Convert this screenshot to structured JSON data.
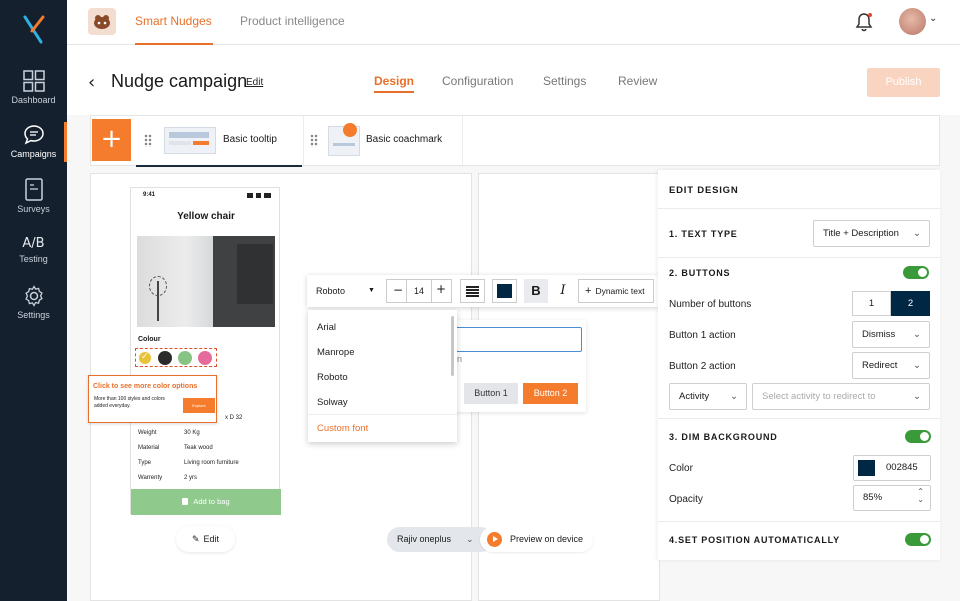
{
  "sidebar": {
    "items": [
      {
        "label": "Dashboard",
        "icon": "grid-icon"
      },
      {
        "label": "Campaigns",
        "icon": "chat-icon",
        "active": true
      },
      {
        "label": "Surveys",
        "icon": "document-icon"
      },
      {
        "label": "Testing",
        "icon": "ab-icon",
        "glyph": "A/B"
      },
      {
        "label": "Settings",
        "icon": "gear-icon"
      }
    ]
  },
  "topbar": {
    "tabs": [
      {
        "label": "Smart Nudges",
        "active": true
      },
      {
        "label": "Product intelligence"
      }
    ]
  },
  "header": {
    "title": "Nudge campaign",
    "edit_link": "Edit",
    "tabs": [
      "Design",
      "Configuration",
      "Settings",
      "Review"
    ],
    "active_tab": "Design",
    "publish_label": "Publish"
  },
  "templates": [
    {
      "label": "Basic tooltip",
      "active": true
    },
    {
      "label": "Basic coachmark"
    }
  ],
  "phone": {
    "time": "9:41",
    "product_title": "Yellow chair",
    "colour_label": "Colour",
    "colors": [
      "#e9c23b",
      "#2b2b2b",
      "#86c483",
      "#e46b9b"
    ],
    "tooltip": {
      "title": "Click to see more color options",
      "body": "More than 100 styles and colors added everyday.",
      "button": "Explore"
    },
    "partial_text": "x D 32",
    "specs": [
      {
        "key": "Weight",
        "value": "30 Kg"
      },
      {
        "key": "Material",
        "value": "Teak wood"
      },
      {
        "key": "Type",
        "value": "Living room furniture"
      },
      {
        "key": "Warrenty",
        "value": "2 yrs"
      }
    ],
    "add_to_bag": "Add to bag",
    "edit_label": "Edit"
  },
  "text_toolbar": {
    "font": "Roboto",
    "size": "14",
    "dynamic_text": "Dynamic text",
    "font_options": [
      "Arial",
      "Manrope",
      "Roboto",
      "Solway"
    ],
    "custom_font": "Custom font"
  },
  "preview_card": {
    "partial_text": "n",
    "button1": "Button 1",
    "button2": "Button 2"
  },
  "preview_bar": {
    "device": "Rajiv oneplus",
    "preview_label": "Preview on device"
  },
  "edit_design": {
    "title": "EDIT DESIGN",
    "text_type": {
      "label": "1. TEXT TYPE",
      "value": "Title + Description"
    },
    "buttons": {
      "label": "2. BUTTONS",
      "count_label": "Number of buttons",
      "count_options": [
        "1",
        "2"
      ],
      "selected": "2",
      "button1_action_label": "Button 1 action",
      "button1_action": "Dismiss",
      "button2_action_label": "Button 2 action",
      "button2_action": "Redirect",
      "redirect_type": "Activity",
      "activity_placeholder": "Select activity to redirect to"
    },
    "dim_background": {
      "label": "3. DIM BACKGROUND",
      "color_label": "Color",
      "color_value": "002845",
      "opacity_label": "Opacity",
      "opacity_value": "85%"
    },
    "position": {
      "label": "4.SET POSITION AUTOMATICALLY"
    }
  },
  "colors": {
    "accent": "#e8702a",
    "sidebar_bg": "#14202e",
    "navy": "#002845",
    "toggle_green": "#3a9a3a",
    "add_to_bag_green": "#8fc98c"
  }
}
